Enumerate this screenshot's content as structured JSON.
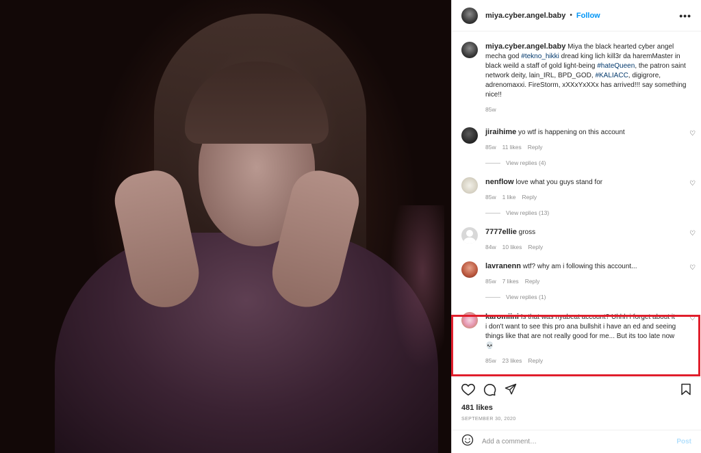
{
  "post": {
    "username": "miya.cyber.angel.baby",
    "follow_label": "Follow",
    "more_icon": "more-dots-icon",
    "separator": "•",
    "caption_text_parts": [
      "Miya the black hearted cyber angel mecha god ",
      "#tekno_hikki",
      " dread king lich kill3r da haremMaster in black weild a staff of gold light-being ",
      "#hateQueen",
      ", the patron saint network deity, lain_IRL, BPD_GOD, ",
      "#KALIACC",
      ", digigrore, adrenomaxxi. FireStorm, xXXxYxXXx has arrived!!! say something nice!!"
    ],
    "caption_time": "85w",
    "likes": "481 likes",
    "date": "SEPTEMBER 30, 2020",
    "add_comment_placeholder": "Add a comment…",
    "post_label": "Post"
  },
  "comments": [
    {
      "username": "jiraihime",
      "text": "yo wtf is happening on this account",
      "time": "85w",
      "likes": "11 likes",
      "reply": "Reply",
      "view_replies": "View replies (4)"
    },
    {
      "username": "nenflow",
      "text": "love what you guys stand for",
      "time": "85w",
      "likes": "1 like",
      "reply": "Reply",
      "view_replies": "View replies (13)"
    },
    {
      "username": "7777ellie",
      "text": "gross",
      "time": "84w",
      "likes": "10 likes",
      "reply": "Reply",
      "view_replies": ""
    },
    {
      "username": "lavranenn",
      "text": "wtf? why am i following this account...",
      "time": "85w",
      "likes": "7 likes",
      "reply": "Reply",
      "view_replies": "View replies (1)"
    },
    {
      "username": "karomiini",
      "text": "Is that was nyabeat account? Uhhh i forget about it i don't want to see this pro ana bullshit i have an ed and seeing things like that are not really good for me... But its too late now 💀",
      "time": "85w",
      "likes": "23 likes",
      "reply": "Reply",
      "view_replies": ""
    }
  ],
  "colors": {
    "link": "#0095f6",
    "highlight": "#e01e2b",
    "hashtag": "#00376b",
    "muted": "#8e8e8e"
  }
}
